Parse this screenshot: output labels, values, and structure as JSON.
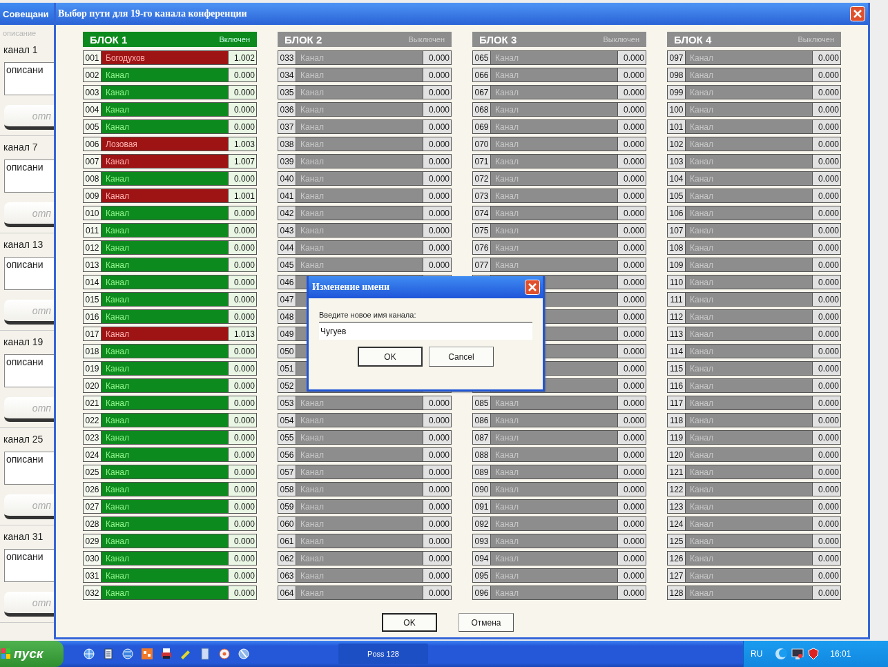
{
  "background_window": {
    "title": "Совещани",
    "header": "описание",
    "channels": [
      {
        "label": "канал 1",
        "description": "описани",
        "button": "отп"
      },
      {
        "label": "канал 7",
        "description": "описани",
        "button": "отп"
      },
      {
        "label": "канал 13",
        "description": "описани",
        "button": "отп"
      },
      {
        "label": "канал 19",
        "description": "описани",
        "button": "отп"
      },
      {
        "label": "канал 25",
        "description": "описани",
        "button": "отп"
      },
      {
        "label": "канал 31",
        "description": "описани",
        "button": "отп"
      }
    ]
  },
  "dialog": {
    "title": "Выбор пути для 19-го канала конференции",
    "blocks": [
      {
        "title": "БЛОК 1",
        "status": "Включен",
        "enabled": true,
        "rows": [
          {
            "number": "001",
            "name": "Богодухов",
            "value": "1.002",
            "busy": true
          },
          {
            "number": "002",
            "name": "Канал",
            "value": "0.000",
            "busy": false
          },
          {
            "number": "003",
            "name": "Канал",
            "value": "0.000",
            "busy": false
          },
          {
            "number": "004",
            "name": "Канал",
            "value": "0.000",
            "busy": false
          },
          {
            "number": "005",
            "name": "Канал",
            "value": "0.000",
            "busy": false
          },
          {
            "number": "006",
            "name": "Лозовая",
            "value": "1.003",
            "busy": true
          },
          {
            "number": "007",
            "name": "Канал",
            "value": "1.007",
            "busy": true
          },
          {
            "number": "008",
            "name": "Канал",
            "value": "0.000",
            "busy": false
          },
          {
            "number": "009",
            "name": "Канал",
            "value": "1.001",
            "busy": true
          },
          {
            "number": "010",
            "name": "Канал",
            "value": "0.000",
            "busy": false
          },
          {
            "number": "011",
            "name": "Канал",
            "value": "0.000",
            "busy": false
          },
          {
            "number": "012",
            "name": "Канал",
            "value": "0.000",
            "busy": false
          },
          {
            "number": "013",
            "name": "Канал",
            "value": "0.000",
            "busy": false
          },
          {
            "number": "014",
            "name": "Канал",
            "value": "0.000",
            "busy": false
          },
          {
            "number": "015",
            "name": "Канал",
            "value": "0.000",
            "busy": false
          },
          {
            "number": "016",
            "name": "Канал",
            "value": "0.000",
            "busy": false
          },
          {
            "number": "017",
            "name": "Канал",
            "value": "1.013",
            "busy": true
          },
          {
            "number": "018",
            "name": "Канал",
            "value": "0.000",
            "busy": false
          },
          {
            "number": "019",
            "name": "Канал",
            "value": "0.000",
            "busy": false
          },
          {
            "number": "020",
            "name": "Канал",
            "value": "0.000",
            "busy": false
          },
          {
            "number": "021",
            "name": "Канал",
            "value": "0.000",
            "busy": false
          },
          {
            "number": "022",
            "name": "Канал",
            "value": "0.000",
            "busy": false
          },
          {
            "number": "023",
            "name": "Канал",
            "value": "0.000",
            "busy": false
          },
          {
            "number": "024",
            "name": "Канал",
            "value": "0.000",
            "busy": false
          },
          {
            "number": "025",
            "name": "Канал",
            "value": "0.000",
            "busy": false
          },
          {
            "number": "026",
            "name": "Канал",
            "value": "0.000",
            "busy": false
          },
          {
            "number": "027",
            "name": "Канал",
            "value": "0.000",
            "busy": false
          },
          {
            "number": "028",
            "name": "Канал",
            "value": "0.000",
            "busy": false
          },
          {
            "number": "029",
            "name": "Канал",
            "value": "0.000",
            "busy": false
          },
          {
            "number": "030",
            "name": "Канал",
            "value": "0.000",
            "busy": false
          },
          {
            "number": "031",
            "name": "Канал",
            "value": "0.000",
            "busy": false
          },
          {
            "number": "032",
            "name": "Канал",
            "value": "0.000",
            "busy": false
          }
        ]
      },
      {
        "title": "БЛОК 2",
        "status": "Выключен",
        "enabled": false,
        "rows": [
          {
            "number": "033",
            "name": "Канал",
            "value": "0.000"
          },
          {
            "number": "034",
            "name": "Канал",
            "value": "0.000"
          },
          {
            "number": "035",
            "name": "Канал",
            "value": "0.000"
          },
          {
            "number": "036",
            "name": "Канал",
            "value": "0.000"
          },
          {
            "number": "037",
            "name": "Канал",
            "value": "0.000"
          },
          {
            "number": "038",
            "name": "Канал",
            "value": "0.000"
          },
          {
            "number": "039",
            "name": "Канал",
            "value": "0.000"
          },
          {
            "number": "040",
            "name": "Канал",
            "value": "0.000"
          },
          {
            "number": "041",
            "name": "Канал",
            "value": "0.000"
          },
          {
            "number": "042",
            "name": "Канал",
            "value": "0.000"
          },
          {
            "number": "043",
            "name": "Канал",
            "value": "0.000"
          },
          {
            "number": "044",
            "name": "Канал",
            "value": "0.000"
          },
          {
            "number": "045",
            "name": "Канал",
            "value": "0.000"
          },
          {
            "number": "046"
          },
          {
            "number": "047"
          },
          {
            "number": "048"
          },
          {
            "number": "049"
          },
          {
            "number": "050"
          },
          {
            "number": "051"
          },
          {
            "number": "052"
          },
          {
            "number": "053",
            "name": "Канал",
            "value": "0.000"
          },
          {
            "number": "054",
            "name": "Канал",
            "value": "0.000"
          },
          {
            "number": "055",
            "name": "Канал",
            "value": "0.000"
          },
          {
            "number": "056",
            "name": "Канал",
            "value": "0.000"
          },
          {
            "number": "057",
            "name": "Канал",
            "value": "0.000"
          },
          {
            "number": "058",
            "name": "Канал",
            "value": "0.000"
          },
          {
            "number": "059",
            "name": "Канал",
            "value": "0.000"
          },
          {
            "number": "060",
            "name": "Канал",
            "value": "0.000"
          },
          {
            "number": "061",
            "name": "Канал",
            "value": "0.000"
          },
          {
            "number": "062",
            "name": "Канал",
            "value": "0.000"
          },
          {
            "number": "063",
            "name": "Канал",
            "value": "0.000"
          },
          {
            "number": "064",
            "name": "Канал",
            "value": "0.000"
          }
        ]
      },
      {
        "title": "БЛОК 3",
        "status": "Выключен",
        "enabled": false,
        "rows": [
          {
            "number": "065",
            "name": "Канал",
            "value": "0.000"
          },
          {
            "number": "066",
            "name": "Канал",
            "value": "0.000"
          },
          {
            "number": "067",
            "name": "Канал",
            "value": "0.000"
          },
          {
            "number": "068",
            "name": "Канал",
            "value": "0.000"
          },
          {
            "number": "069",
            "name": "Канал",
            "value": "0.000"
          },
          {
            "number": "070",
            "name": "Канал",
            "value": "0.000"
          },
          {
            "number": "071",
            "name": "Канал",
            "value": "0.000"
          },
          {
            "number": "072",
            "name": "Канал",
            "value": "0.000"
          },
          {
            "number": "073",
            "name": "Канал",
            "value": "0.000"
          },
          {
            "number": "074",
            "name": "Канал",
            "value": "0.000"
          },
          {
            "number": "075",
            "name": "Канал",
            "value": "0.000"
          },
          {
            "number": "076",
            "name": "Канал",
            "value": "0.000"
          },
          {
            "number": "077",
            "name": "Канал",
            "value": "0.000"
          },
          {
            "value": "0.000"
          },
          {
            "value": "0.000"
          },
          {
            "value": "0.000"
          },
          {
            "value": "0.000"
          },
          {
            "value": "0.000"
          },
          {
            "value": "0.000"
          },
          {
            "value": "0.000"
          },
          {
            "number": "085",
            "name": "Канал",
            "value": "0.000"
          },
          {
            "number": "086",
            "name": "Канал",
            "value": "0.000"
          },
          {
            "number": "087",
            "name": "Канал",
            "value": "0.000"
          },
          {
            "number": "088",
            "name": "Канал",
            "value": "0.000"
          },
          {
            "number": "089",
            "name": "Канал",
            "value": "0.000"
          },
          {
            "number": "090",
            "name": "Канал",
            "value": "0.000"
          },
          {
            "number": "091",
            "name": "Канал",
            "value": "0.000"
          },
          {
            "number": "092",
            "name": "Канал",
            "value": "0.000"
          },
          {
            "number": "093",
            "name": "Канал",
            "value": "0.000"
          },
          {
            "number": "094",
            "name": "Канал",
            "value": "0.000"
          },
          {
            "number": "095",
            "name": "Канал",
            "value": "0.000"
          },
          {
            "number": "096",
            "name": "Канал",
            "value": "0.000"
          }
        ]
      },
      {
        "title": "БЛОК 4",
        "status": "Выключен",
        "enabled": false,
        "rows": [
          {
            "number": "097",
            "name": "Канал",
            "value": "0.000"
          },
          {
            "number": "098",
            "name": "Канал",
            "value": "0.000"
          },
          {
            "number": "099",
            "name": "Канал",
            "value": "0.000"
          },
          {
            "number": "100",
            "name": "Канал",
            "value": "0.000"
          },
          {
            "number": "101",
            "name": "Канал",
            "value": "0.000"
          },
          {
            "number": "102",
            "name": "Канал",
            "value": "0.000"
          },
          {
            "number": "103",
            "name": "Канал",
            "value": "0.000"
          },
          {
            "number": "104",
            "name": "Канал",
            "value": "0.000"
          },
          {
            "number": "105",
            "name": "Канал",
            "value": "0.000"
          },
          {
            "number": "106",
            "name": "Канал",
            "value": "0.000"
          },
          {
            "number": "107",
            "name": "Канал",
            "value": "0.000"
          },
          {
            "number": "108",
            "name": "Канал",
            "value": "0.000"
          },
          {
            "number": "109",
            "name": "Канал",
            "value": "0.000"
          },
          {
            "number": "110",
            "name": "Канал",
            "value": "0.000"
          },
          {
            "number": "111",
            "name": "Канал",
            "value": "0.000"
          },
          {
            "number": "112",
            "name": "Канал",
            "value": "0.000"
          },
          {
            "number": "113",
            "name": "Канал",
            "value": "0.000"
          },
          {
            "number": "114",
            "name": "Канал",
            "value": "0.000"
          },
          {
            "number": "115",
            "name": "Канал",
            "value": "0.000"
          },
          {
            "number": "116",
            "name": "Канал",
            "value": "0.000"
          },
          {
            "number": "117",
            "name": "Канал",
            "value": "0.000"
          },
          {
            "number": "118",
            "name": "Канал",
            "value": "0.000"
          },
          {
            "number": "119",
            "name": "Канал",
            "value": "0.000"
          },
          {
            "number": "120",
            "name": "Канал",
            "value": "0.000"
          },
          {
            "number": "121",
            "name": "Канал",
            "value": "0.000"
          },
          {
            "number": "122",
            "name": "Канал",
            "value": "0.000"
          },
          {
            "number": "123",
            "name": "Канал",
            "value": "0.000"
          },
          {
            "number": "124",
            "name": "Канал",
            "value": "0.000"
          },
          {
            "number": "125",
            "name": "Канал",
            "value": "0.000"
          },
          {
            "number": "126",
            "name": "Канал",
            "value": "0.000"
          },
          {
            "number": "127",
            "name": "Канал",
            "value": "0.000"
          },
          {
            "number": "128",
            "name": "Канал",
            "value": "0.000"
          }
        ]
      }
    ],
    "buttons": [
      "OK",
      "Отмена"
    ]
  },
  "rename_dialog": {
    "title": "Изменение имени",
    "prompt": "Введите новое имя канала:",
    "value": "Чугуев",
    "buttons": [
      "OK",
      "Cancel"
    ]
  },
  "taskbar": {
    "start": "пуск",
    "tasks": [
      "Poss 128"
    ],
    "language": "RU",
    "clock": "16:01"
  }
}
